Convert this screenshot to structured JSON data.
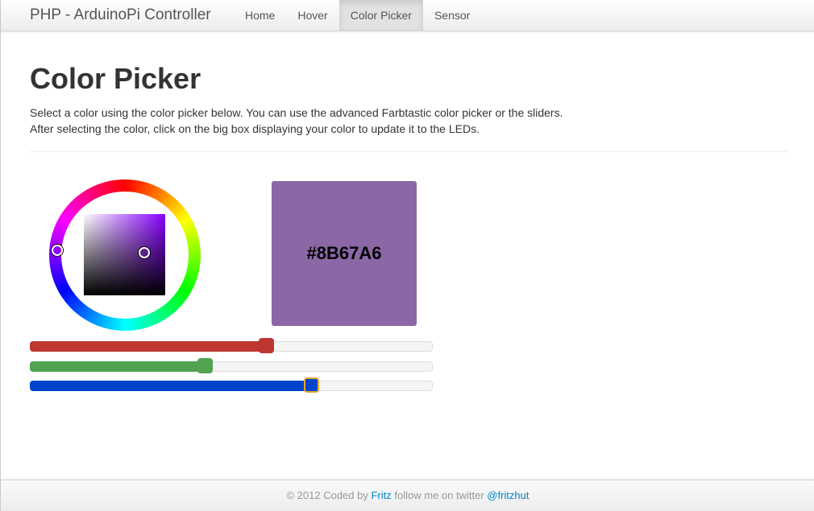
{
  "navbar": {
    "brand": "PHP - ArduinoPi Controller",
    "items": [
      {
        "label": "Home",
        "active": false
      },
      {
        "label": "Hover",
        "active": false
      },
      {
        "label": "Color Picker",
        "active": true
      },
      {
        "label": "Sensor",
        "active": false
      }
    ]
  },
  "header": {
    "title": "Color Picker",
    "description_line1": "Select a color using the color picker below. You can use the advanced Farbtastic color picker or the sliders.",
    "description_line2": "After selecting the color, click on the big box displaying your color to update it to the LEDs."
  },
  "picker": {
    "current_color": "#8B67A6",
    "preview_label": "#8B67A6",
    "hue_color": "#8800ff"
  },
  "sliders": [
    {
      "channel": "red",
      "value": 139,
      "max": 255,
      "color": "#bd362f"
    },
    {
      "channel": "green",
      "value": 103,
      "max": 255,
      "color": "#51a351"
    },
    {
      "channel": "blue",
      "value": 166,
      "max": 255,
      "color": "#0044cc"
    }
  ],
  "footer": {
    "prefix": "© 2012 Coded by",
    "author_link": "Fritz",
    "middle": "follow me on twitter",
    "twitter_link": "@fritzhut"
  }
}
